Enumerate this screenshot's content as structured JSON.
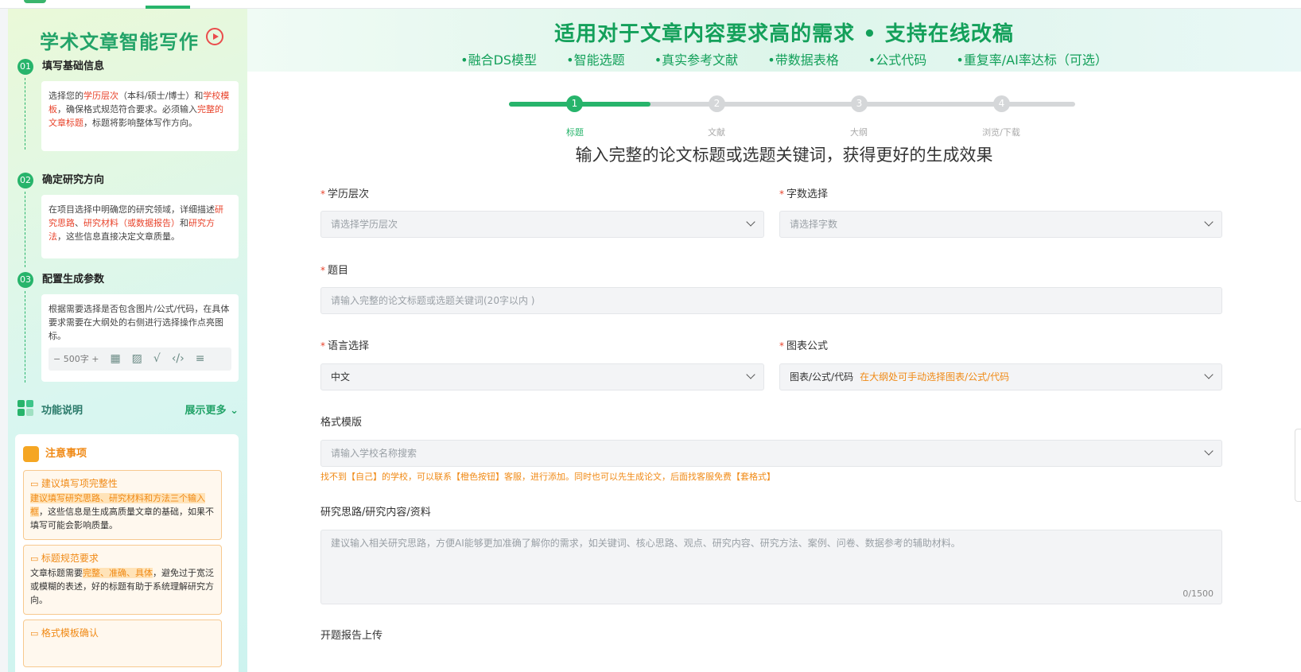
{
  "sidebar": {
    "title": "学术文章智能写作",
    "steps": [
      {
        "num": "01",
        "title": "填写基础信息"
      },
      {
        "num": "02",
        "title": "确定研究方向"
      },
      {
        "num": "03",
        "title": "配置生成参数"
      }
    ],
    "step1": {
      "p1": "选择您的",
      "h1": "学历层次",
      "p2": "（本科/硕士/博士）和",
      "h2": "学校模板",
      "p3": "，确保格式规范符合要求。必须输入",
      "h3": "完整的文章标题",
      "p4": "，标题将影响整体写作方向。"
    },
    "step2": {
      "p1": "在项目选择中明确您的研究领域，详细描述",
      "h1": "研究思路",
      "p2": "、",
      "h2": "研究材料（或数据报告）",
      "p3": "和",
      "h3": "研究方法",
      "p4": "，这些信息直接决定文章质量。"
    },
    "step3": {
      "text": "根据需要选择是否包含图片/公式/代码，在具体要求需要在大纲处的右侧进行选择操作点亮图标。",
      "minus": "−",
      "words": "500字",
      "plus": "+"
    },
    "func_label": "功能说明",
    "func_more": "展示更多",
    "notice_title": "注意事项",
    "notes": [
      {
        "title": "建议填写项完整性",
        "h": "建议填写研究思路、研究材料和方法三个输入框",
        "text": "，这些信息是生成高质量文章的基础，如果不填写可能会影响质量。"
      },
      {
        "title": "标题规范要求",
        "pre": "文章标题需要",
        "h": "完整、准确、具体",
        "text": "，避免过于宽泛或模糊的表述，好的标题有助于系统理解研究方向。"
      },
      {
        "title": "格式模板确认"
      }
    ]
  },
  "banner": {
    "title": "适用对于文章内容要求高的需求 • 支持在线改稿",
    "features": [
      "•融合DS模型",
      "•智能选题",
      "•真实参考文献",
      "•带数据表格",
      "•公式代码",
      "•重复率/AI率达标（可选）"
    ]
  },
  "progress": {
    "steps": [
      {
        "num": "1",
        "label": "标题"
      },
      {
        "num": "2",
        "label": "文献"
      },
      {
        "num": "3",
        "label": "大纲"
      },
      {
        "num": "4",
        "label": "浏览/下载"
      }
    ],
    "current": 1,
    "fill_fraction": 0.25
  },
  "form": {
    "subtitle": "输入完整的论文标题或选题关键词，获得更好的生成效果",
    "req_mark": "*",
    "education_label": "学历层次",
    "education_placeholder": "请选择学历层次",
    "words_label": "字数选择",
    "words_placeholder": "请选择字数",
    "title_label": "题目",
    "title_placeholder": "请输入完整的论文标题或选题关键词(20字以内 )",
    "language_label": "语言选择",
    "language_value": "中文",
    "chart_label": "图表公式",
    "chart_value": "图表/公式/代码",
    "chart_hint": "在大纲处可手动选择图表/公式/代码",
    "template_label": "格式模版",
    "template_placeholder": "请输入学校名称搜索",
    "template_tip": "找不到【自己】的学校，可以联系【橙色按钮】客服，进行添加。同时也可以先生成论文，后面找客服免费【套格式】",
    "research_label": "研究思路/研究内容/资料",
    "research_placeholder": "建议输入相关研究思路，方便AI能够更加准确了解你的需求，如关键词、核心思路、观点、研究内容、研究方法、案例、问卷、数据参考的辅助材料。",
    "research_counter": "0/1500",
    "upload_label": "开题报告上传"
  },
  "colors": {
    "accent": "#27b46b",
    "highlight_red": "#e8432b",
    "warn_orange": "#f08a16"
  }
}
